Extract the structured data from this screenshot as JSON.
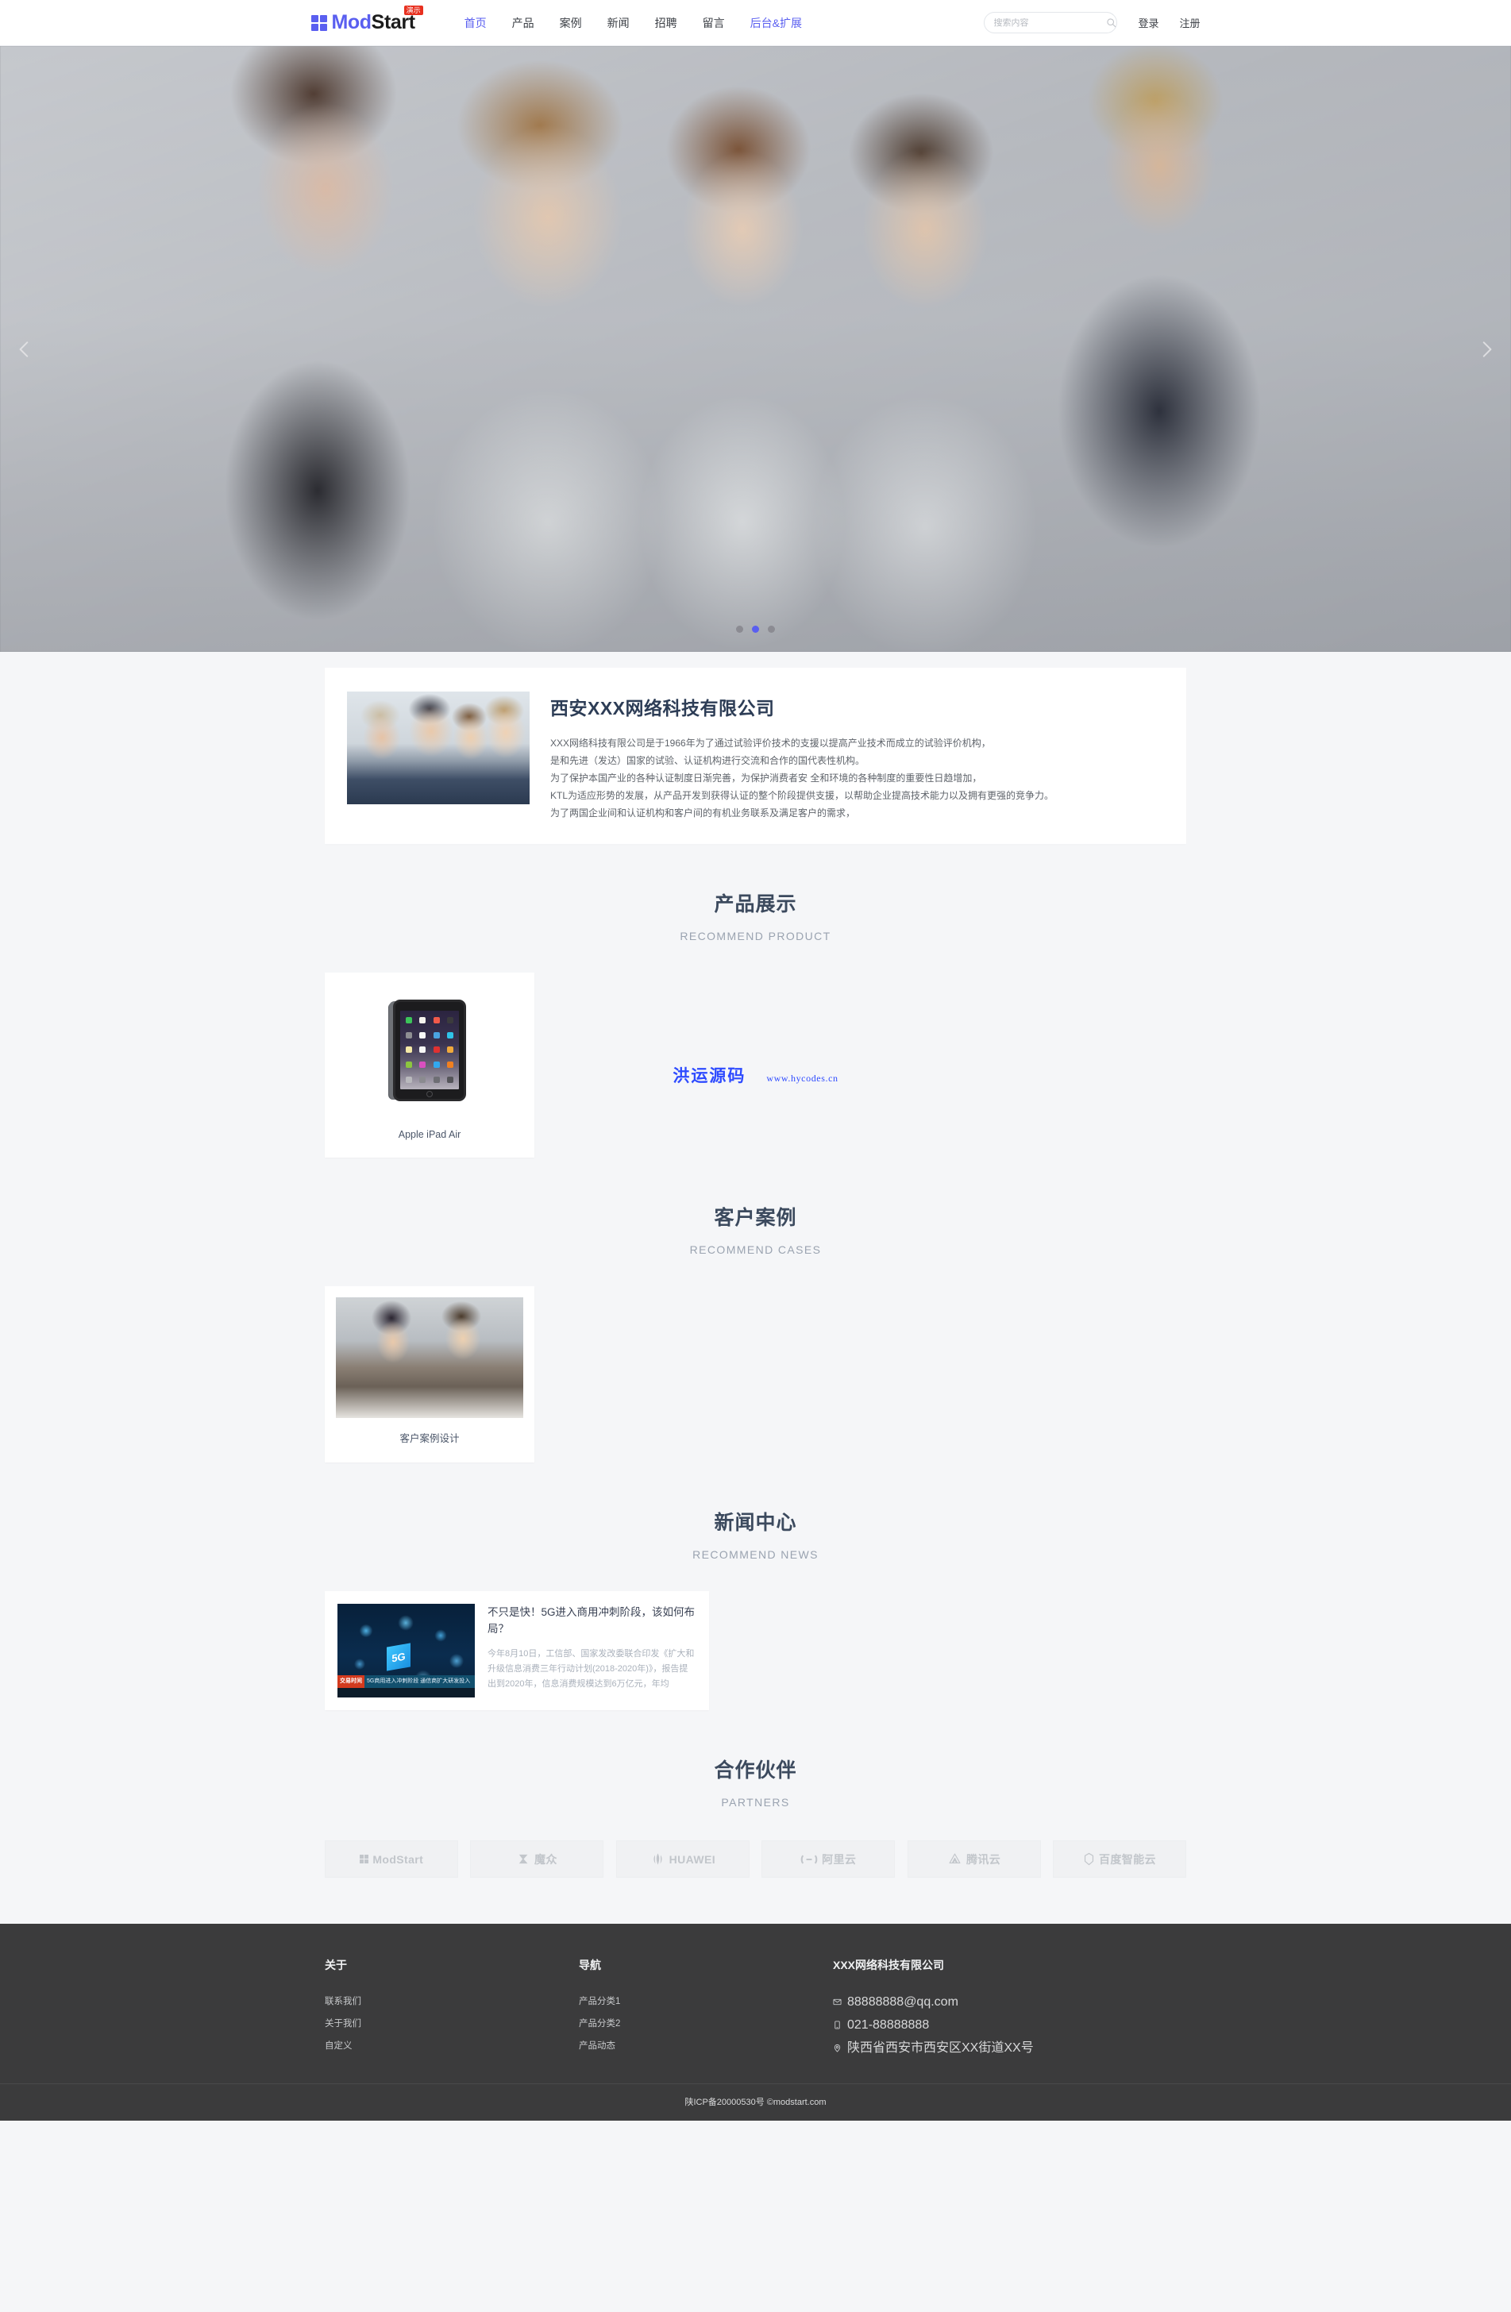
{
  "header": {
    "logo": {
      "mod": "Mod",
      "start": "Start",
      "badge": "演示",
      "icon": "grid-logo-icon"
    },
    "nav": [
      {
        "label": "首页",
        "state": "active"
      },
      {
        "label": "产品",
        "state": "normal"
      },
      {
        "label": "案例",
        "state": "normal"
      },
      {
        "label": "新闻",
        "state": "normal"
      },
      {
        "label": "招聘",
        "state": "normal"
      },
      {
        "label": "留言",
        "state": "normal"
      },
      {
        "label": "后台&扩展",
        "state": "accent"
      }
    ],
    "search": {
      "placeholder": "搜索内容",
      "value": "",
      "icon": "search-icon"
    },
    "login_label": "登录",
    "register_label": "注册"
  },
  "hero": {
    "prev_icon": "chevron-left-icon",
    "next_icon": "chevron-right-icon",
    "slides": 3,
    "active_slide": 2,
    "active_dot_color": "#5a5ff0"
  },
  "intro": {
    "title": "西安XXX网络科技有限公司",
    "image_alt": "business-meeting-photo",
    "paragraphs": [
      "XXX网络科技有限公司是于1966年为了通过试验评价技术的支援以提高产业技术而成立的试验评价机构，",
      "是和先进（发达）国家的试验、认证机构进行交流和合作的国代表性机构。",
      "为了保护本国产业的各种认证制度日渐完善，为保护消费者安 全和环境的各种制度的重要性日趋增加，",
      "KTL为适应形势的发展，从产品开发到获得认证的整个阶段提供支援，以帮助企业提高技术能力以及拥有更强的竞争力。",
      "为了两国企业间和认证机构和客户间的有机业务联系及满足客户的需求，"
    ]
  },
  "watermark": {
    "cn": "洪运源码",
    "url": "www.hycodes.cn",
    "color": "#2e4bff"
  },
  "sections": {
    "product": {
      "title": "产品展示",
      "subtitle": "RECOMMEND PRODUCT",
      "items": [
        {
          "caption": "Apple iPad Air",
          "image_alt": "ipad-air-product-image"
        }
      ]
    },
    "cases": {
      "title": "客户案例",
      "subtitle": "RECOMMEND CASES",
      "items": [
        {
          "caption": "客户案例设计",
          "image_alt": "case-study-photo"
        }
      ]
    },
    "news": {
      "title": "新闻中心",
      "subtitle": "RECOMMEND NEWS",
      "items": [
        {
          "title": "不只是快！5G进入商用冲刺阶段，该如何布局？",
          "desc": "今年8月10日，工信部、国家发改委联合印发《扩大和升级信息消费三年行动计划(2018-2020年)》，报告提出到2020年，信息消费规模达到6万亿元，年均",
          "thumb_alt": "5g-network-news-thumbnail",
          "thumb_label": "5G",
          "thumb_strip_red": "交易时间",
          "thumb_strip_blue": "5G商用进入冲刺阶段 通信商扩大研发投入"
        }
      ]
    },
    "partners": {
      "title": "合作伙伴",
      "subtitle": "PARTNERS",
      "items": [
        {
          "name": "ModStart",
          "icon": "modstart-logo-icon"
        },
        {
          "name": "魔众",
          "icon": "mozhong-logo-icon"
        },
        {
          "name": "HUAWEI",
          "icon": "huawei-logo-icon"
        },
        {
          "name": "阿里云",
          "icon": "aliyun-logo-icon"
        },
        {
          "name": "腾讯云",
          "icon": "tencent-cloud-logo-icon"
        },
        {
          "name": "百度智能云",
          "icon": "baidu-cloud-logo-icon"
        }
      ]
    }
  },
  "footer": {
    "columns": [
      {
        "heading": "关于",
        "links": [
          "联系我们",
          "关于我们",
          "自定义"
        ]
      },
      {
        "heading": "导航",
        "links": [
          "产品分类1",
          "产品分类2",
          "产品动态"
        ]
      }
    ],
    "contact": {
      "heading": "XXX网络科技有限公司",
      "email": "88888888@qq.com",
      "phone": "021-88888888",
      "address": "陕西省西安市西安区XX街道XX号",
      "email_icon": "mail-icon",
      "phone_icon": "phone-icon",
      "address_icon": "location-pin-icon"
    },
    "copyright": "陕ICP备20000530号 ©modstart.com"
  }
}
